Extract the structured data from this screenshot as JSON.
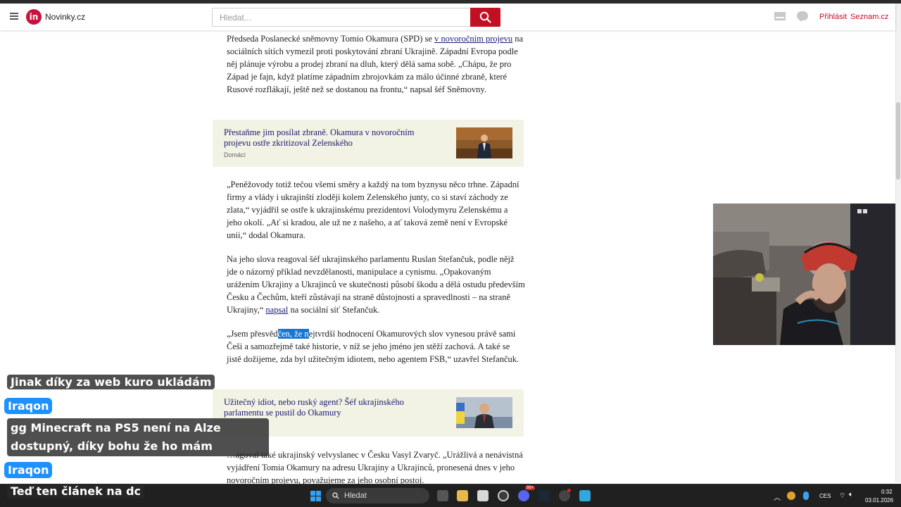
{
  "header": {
    "logo_text": "in",
    "site_name": "Novinky.cz",
    "search_placeholder": "Hledat...",
    "login": "Přihlásit",
    "seznam": "Seznam.cz"
  },
  "article": {
    "p1_a": "Předseda Poslanecké sněmovny Tomio Okamura (SPD) se ",
    "p1_link": "v novoročním projevu",
    "p1_b": " na sociálních sítích vymezil proti poskytování zbraní Ukrajině. Západní Evropa podle něj plánuje výrobu a prodej zbraní na dluh, který dělá sama sobě. „Chápu, že pro Západ je fajn, když platíme západním zbrojovkám za málo účinné zbraně, které Rusové rozflákají, ještě než se dostanou na frontu,“ napsal šéf Sněmovny.",
    "box1_title": "Přestaňme jim posílat zbraně. Okamura v novoročním projevu ostře zkritizoval Zelenského",
    "box1_tag": "Domácí",
    "p2": "„Peněžovody totiž tečou všemi směry a každý na tom byznysu něco trhne. Západní firmy a vlády i ukrajinští zloději kolem Zelenského junty, co si staví záchody ze zlata,“ vyjádřil se ostře k ukrajinskému prezidentovi Volodymyru Zelenskému a jeho okolí. „Ať si kradou, ale už ne z našeho, a ať taková země není v Evropské unii,“ dodal Okamura.",
    "p3_a": "Na jeho slova reagoval šéf ukrajinského parlamentu Ruslan Stefančuk, podle nějž jde o názorný příklad nevzdělanosti, manipulace a cynismu. „Opakovaným urážením Ukrajiny a Ukrajinců ve skutečnosti působí škodu a dělá ostudu především Česku a Čechům, kteří zůstávají na straně důstojnosti a spravedlnosti – na straně Ukrajiny,“ ",
    "p3_link": "napsal",
    "p3_b": " na sociální síť Stefančuk.",
    "p4_a": "„Jsem přesvěd",
    "p4_hl": "čen, že n",
    "p4_b": "ejtvrdší hodnocení Okamurových slov vynesou právě sami Češi a samozřejmě také historie, v níž se jeho jméno jen stěží zachová. A také se jistě dožijeme, zda byl užitečným idiotem, nebo agentem FSB,“ uzavřel Stefančuk.",
    "box2_title": "Užitečný idiot, nebo ruský agent? Šéf ukrajinského parlamentu se pustil do Okamury",
    "p5": "…agoval také ukrajinský velvyslanec v Česku Vasyl Zvaryč. „Urážlivá a nenávistná vyjádření Tomia Okamury na adresu Ukrajiny a Ukrajinců, pronesená dnes v jeho novoročním projevu, považujeme za jeho osobní postoj."
  },
  "chat": {
    "m1": "Jinak díky za web kuro ukládám",
    "u1": "Iraqon",
    "m2a": "gg Minecraft na PS5 není na Alze",
    "m2b": "dostupný, díky bohu že ho mám",
    "u2": "Iraqon",
    "m3": "Teď ten článek na dc"
  },
  "taskbar": {
    "search": "Hledat",
    "lang": "CES",
    "time": "0:32",
    "date": "03.01.2026",
    "badge": "99+"
  },
  "colors": {
    "brand": "#c30f23",
    "link": "#1a1a6e",
    "box_bg": "#f2f2e5",
    "chat_user": "#1e90ff"
  }
}
